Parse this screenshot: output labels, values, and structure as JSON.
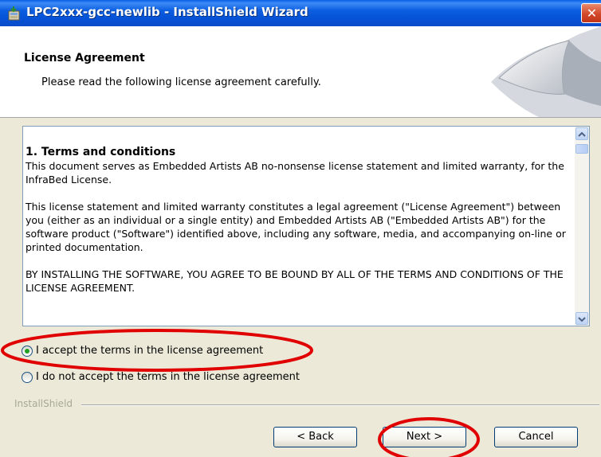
{
  "window": {
    "title": "LPC2xxx-gcc-newlib - InstallShield Wizard",
    "close_glyph": "✕"
  },
  "header": {
    "title": "License Agreement",
    "subtitle": "Please read the following license agreement carefully."
  },
  "license": {
    "heading": "1. Terms and conditions",
    "paragraphs": [
      "This document serves as Embedded Artists AB no-nonsense license statement and limited warranty, for the InfraBed License.",
      "This license statement and limited warranty constitutes a legal agreement (\"License Agreement\") between you (either as an individual or a single entity) and Embedded Artists AB (\"Embedded Artists AB\") for the software product (\"Software\") identified above, including any software, media, and accompanying on-line or printed documentation.",
      "BY INSTALLING THE SOFTWARE, YOU AGREE TO BE BOUND BY ALL OF THE TERMS AND CONDITIONS OF THE LICENSE AGREEMENT."
    ]
  },
  "options": {
    "accept_label": "I accept the terms in the license agreement",
    "decline_label": "I do not accept the terms in the license agreement",
    "selected": "accept"
  },
  "footer": {
    "brand": "InstallShield",
    "back_label": "< Back",
    "next_label": "Next >",
    "cancel_label": "Cancel"
  },
  "icons": {
    "app": "installer-icon",
    "close": "close-icon",
    "scroll_up": "arrow-up-icon",
    "scroll_down": "arrow-down-icon"
  },
  "colors": {
    "titlebar": "#0a5fe6",
    "annotation": "#e00000",
    "radio_selected": "#21a121"
  }
}
